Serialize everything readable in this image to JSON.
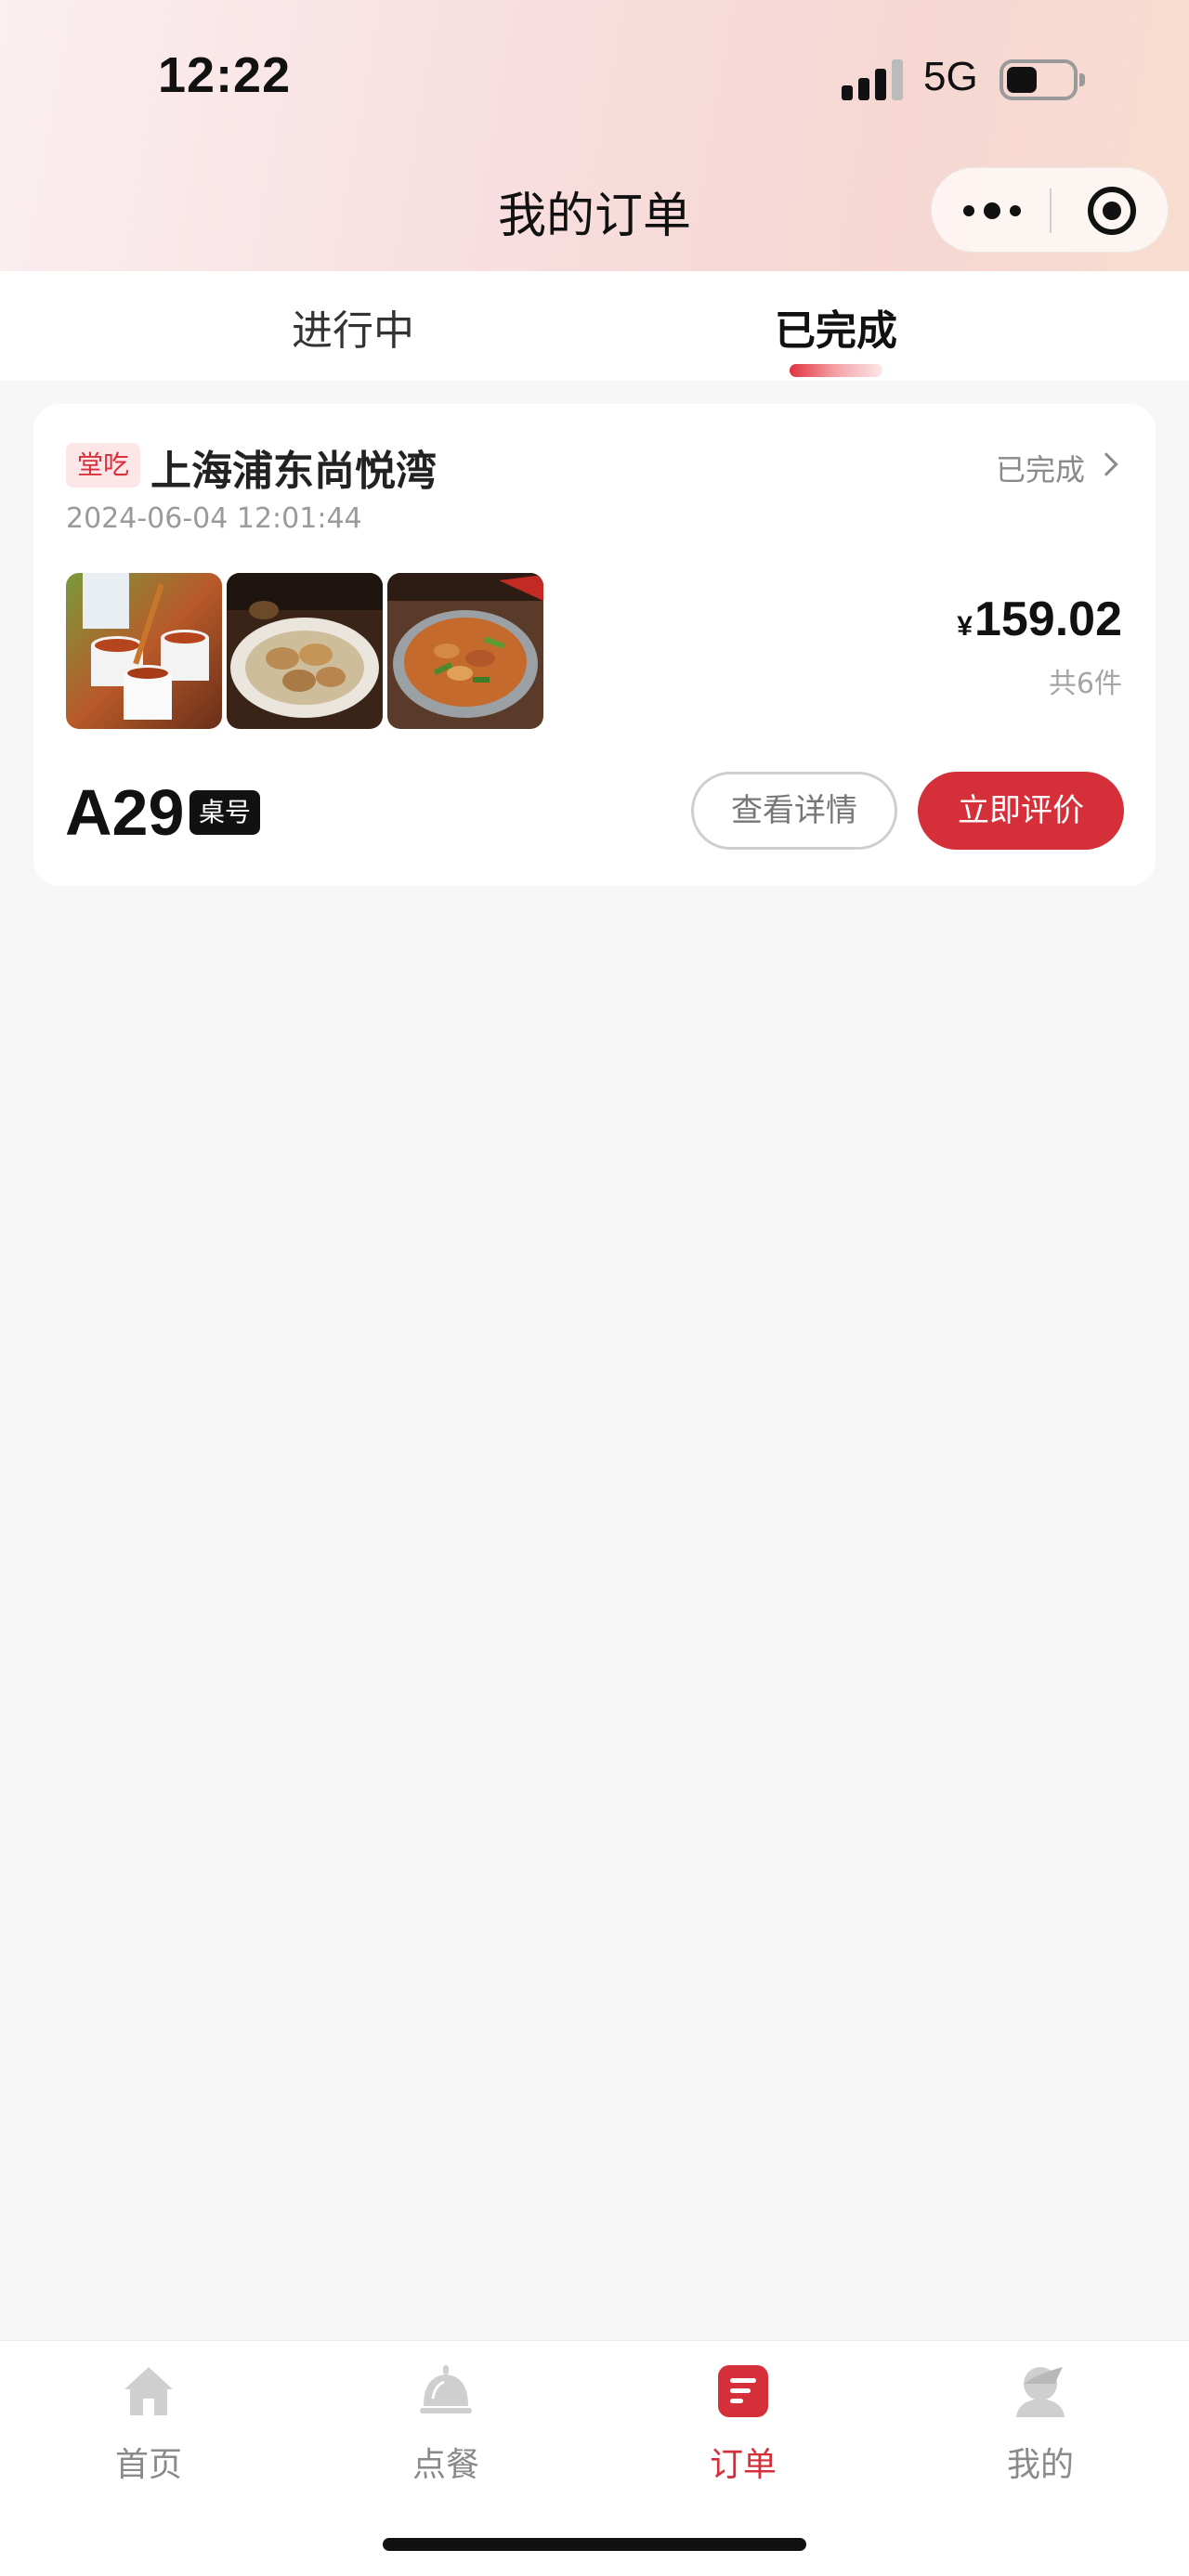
{
  "status_bar": {
    "time": "12:22",
    "network": "5G"
  },
  "nav": {
    "title": "我的订单"
  },
  "tabs": [
    {
      "label": "进行中",
      "active": false
    },
    {
      "label": "已完成",
      "active": true
    }
  ],
  "orders": [
    {
      "type_tag": "堂吃",
      "store_name": "上海浦东尚悦湾",
      "status": "已完成",
      "datetime": "2024-06-04 12:01:44",
      "currency": "¥",
      "amount": "159.02",
      "item_count": "共6件",
      "table_no": "A29",
      "table_tag": "桌号",
      "detail_button": "查看详情",
      "review_button": "立即评价",
      "thumbnails": [
        "tea-cups-image",
        "dumplings-plate-image",
        "stir-fry-pot-image"
      ]
    }
  ],
  "tabbar": [
    {
      "label": "首页",
      "icon": "home-icon",
      "active": false
    },
    {
      "label": "点餐",
      "icon": "service-bell-icon",
      "active": false
    },
    {
      "label": "订单",
      "icon": "order-list-icon",
      "active": true
    },
    {
      "label": "我的",
      "icon": "profile-icon",
      "active": false
    }
  ],
  "colors": {
    "accent": "#d5303a",
    "tag_bg": "#fde6e7",
    "background": "#f7f7f7"
  }
}
